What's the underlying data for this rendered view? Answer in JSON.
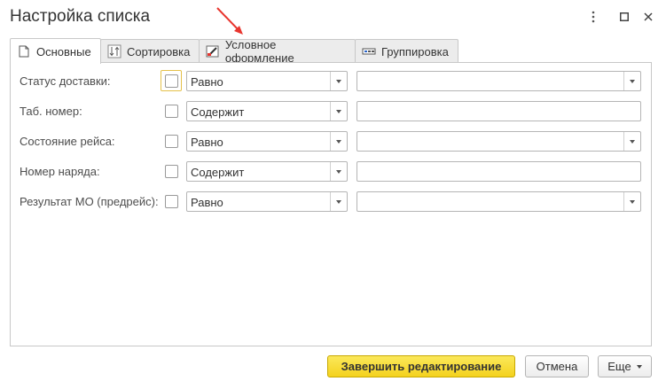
{
  "window": {
    "title": "Настройка списка"
  },
  "tabs": [
    {
      "label": "Основные",
      "icon": "document-icon"
    },
    {
      "label": "Сортировка",
      "icon": "sort-icon"
    },
    {
      "label": "Условное оформление",
      "icon": "conditional-format-icon"
    },
    {
      "label": "Группировка",
      "icon": "grouping-icon"
    }
  ],
  "filters": [
    {
      "label": "Статус доставки:",
      "operator": "Равно",
      "value": "",
      "has_dropdown": true
    },
    {
      "label": "Таб. номер:",
      "operator": "Содержит",
      "value": "",
      "has_dropdown": false
    },
    {
      "label": "Состояние рейса:",
      "operator": "Равно",
      "value": "",
      "has_dropdown": true
    },
    {
      "label": "Номер наряда:",
      "operator": "Содержит",
      "value": "",
      "has_dropdown": false
    },
    {
      "label": "Результат МО (предрейс):",
      "operator": "Равно",
      "value": "",
      "has_dropdown": true
    }
  ],
  "buttons": {
    "finish": "Завершить редактирование",
    "cancel": "Отмена",
    "more": "Еще"
  },
  "colors": {
    "primary_button": "#f4d21e",
    "annotation_arrow": "#e8352e",
    "focus_border": "#e5c14a"
  }
}
